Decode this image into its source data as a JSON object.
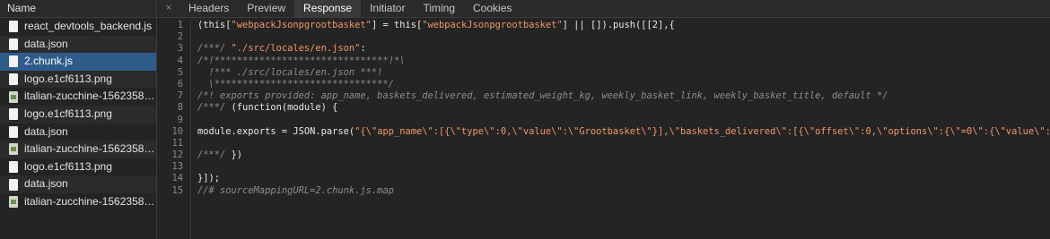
{
  "file_panel": {
    "header": "Name",
    "files": [
      {
        "name": "react_devtools_backend.js",
        "type": "doc"
      },
      {
        "name": "data.json",
        "type": "doc"
      },
      {
        "name": "2.chunk.js",
        "type": "doc"
      },
      {
        "name": "logo.e1cf6113.png",
        "type": "doc"
      },
      {
        "name": "italian-zucchine-1562358.j...",
        "type": "image"
      },
      {
        "name": "logo.e1cf6113.png",
        "type": "doc"
      },
      {
        "name": "data.json",
        "type": "doc"
      },
      {
        "name": "italian-zucchine-1562358.j...",
        "type": "image"
      },
      {
        "name": "logo.e1cf6113.png",
        "type": "doc"
      },
      {
        "name": "data.json",
        "type": "doc"
      },
      {
        "name": "italian-zucchine-1562358.j...",
        "type": "image"
      }
    ],
    "selected_index": 2
  },
  "tabs": {
    "close": "×",
    "items": [
      "Headers",
      "Preview",
      "Response",
      "Initiator",
      "Timing",
      "Cookies"
    ],
    "active": "Response"
  },
  "code": {
    "lines": [
      {
        "n": "1",
        "parts": [
          [
            "pl",
            "(this["
          ],
          [
            "str",
            "\"webpackJsonpgrootbasket\""
          ],
          [
            "pl",
            "] = this["
          ],
          [
            "str",
            "\"webpackJsonpgrootbasket\""
          ],
          [
            "pl",
            "] || []).push([[2],{"
          ]
        ]
      },
      {
        "n": "2",
        "parts": []
      },
      {
        "n": "3",
        "parts": [
          [
            "cm",
            "/***/ "
          ],
          [
            "str",
            "\"./src/locales/en.json\""
          ],
          [
            "pl",
            ":"
          ]
        ]
      },
      {
        "n": "4",
        "parts": [
          [
            "cm",
            "/*!*******************************!*\\"
          ]
        ]
      },
      {
        "n": "5",
        "parts": [
          [
            "cm",
            "  !*** ./src/locales/en.json ***!"
          ]
        ]
      },
      {
        "n": "6",
        "parts": [
          [
            "cm",
            "  \\*******************************/"
          ]
        ]
      },
      {
        "n": "7",
        "parts": [
          [
            "cm",
            "/*! exports provided: app_name, baskets_delivered, estimated_weight_kg, weekly_basket_link, weekly_basket_title, default */"
          ]
        ]
      },
      {
        "n": "8",
        "parts": [
          [
            "cm",
            "/***/ "
          ],
          [
            "pl",
            "(function(module) {"
          ]
        ]
      },
      {
        "n": "9",
        "parts": []
      },
      {
        "n": "10",
        "parts": [
          [
            "pl",
            "module.exports = JSON.parse("
          ],
          [
            "str",
            "\"{\\\"app_name\\\":[{\\\"type\\\":0,\\\"value\\\":\\\"Grootbasket\\\"}],\\\"baskets_delivered\\\":[{\\\"offset\\\":0,\\\"options\\\":{\\\"=0\\\":{\\\"value\\\":[{"
          ]
        ]
      },
      {
        "n": "11",
        "parts": []
      },
      {
        "n": "12",
        "parts": [
          [
            "cm",
            "/***/ "
          ],
          [
            "pl",
            "})"
          ]
        ]
      },
      {
        "n": "13",
        "parts": []
      },
      {
        "n": "14",
        "parts": [
          [
            "pl",
            "}]);"
          ]
        ]
      },
      {
        "n": "15",
        "parts": [
          [
            "cm",
            "//# sourceMappingURL=2.chunk.js.map"
          ]
        ]
      }
    ]
  }
}
